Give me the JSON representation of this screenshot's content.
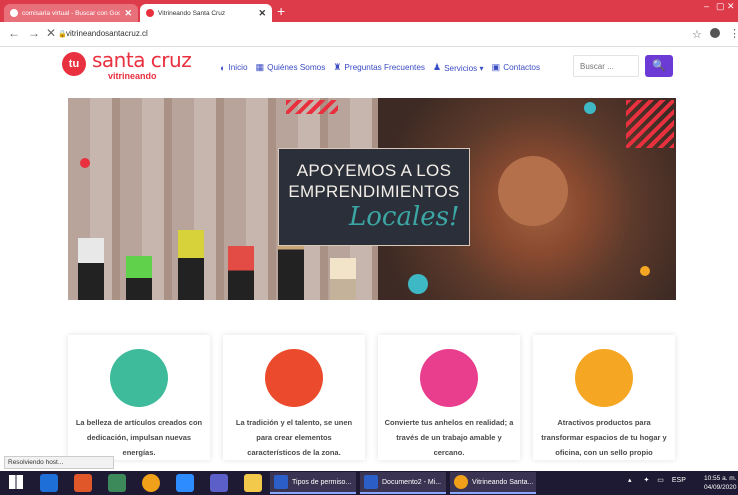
{
  "browser": {
    "tabs": [
      {
        "title": "comisaría virtual - Buscar con Goog",
        "close": "✕"
      },
      {
        "title": "Vitrineando Santa Cruz",
        "close": "✕"
      }
    ],
    "new_tab": "+",
    "window_controls": [
      "–",
      "▢",
      "✕"
    ],
    "url": "vitrineandosantacruz.cl"
  },
  "site": {
    "logo": {
      "badge": "tu",
      "title": "santa cruz",
      "subtitle": "vitrineando"
    },
    "menu": [
      {
        "icon": "home-icon",
        "label": "Inicio"
      },
      {
        "icon": "people-icon",
        "label": "Quiénes Somos"
      },
      {
        "icon": "question-icon",
        "label": "Preguntas Frecuentes"
      },
      {
        "icon": "user-plus-icon",
        "label": "Servicios ▾"
      },
      {
        "icon": "contact-card-icon",
        "label": "Contactos"
      }
    ],
    "search": {
      "placeholder": "Buscar ...",
      "button": "🔍"
    },
    "banner": {
      "line1": "APOYEMOS A LOS",
      "line2": "EMPRENDIMIENTOS",
      "line3": "Locales!"
    },
    "cards": [
      {
        "icon": "belt-icon",
        "color": "#3dbb9a",
        "text": "La belleza de artículos creados con dedicación, impulsan nuevas energías."
      },
      {
        "icon": "origami-bird-icon",
        "color": "#ec4a2c",
        "text": "La tradición y el talento, se unen para crear elementos característicos de la zona."
      },
      {
        "icon": "lightbulb-icon",
        "color": "#e93d8e",
        "text": "Convierte tus anhelos en realidad; a través de un trabajo amable y cercano."
      },
      {
        "icon": "lamp-vase-icon",
        "color": "#f5a623",
        "text": "Atractivos productos para transformar espacios de tu hogar y oficina, con un sello propio"
      }
    ]
  },
  "status_bar": "Resolviendo host...",
  "taskbar": {
    "tasks": [
      "Tipos de permiso...",
      "Documento2 - Mi...",
      "Vitrineando Santa..."
    ],
    "tray_lang": "ESP",
    "time": "10:55 a. m.",
    "date": "04/09/2020"
  }
}
